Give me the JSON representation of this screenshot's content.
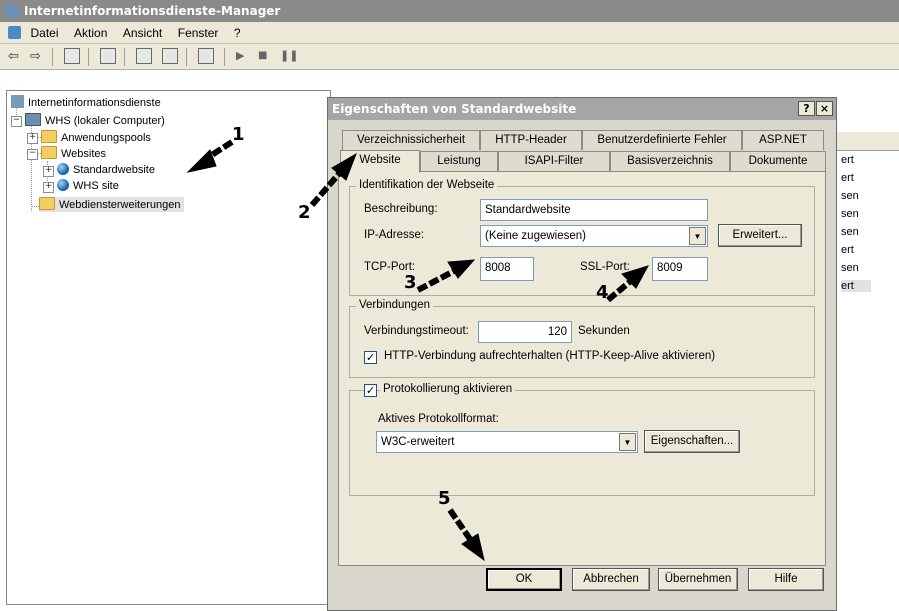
{
  "window": {
    "title": "Internetinformationsdienste-Manager"
  },
  "menu": {
    "items": [
      "Datei",
      "Aktion",
      "Ansicht",
      "Fenster",
      "?"
    ]
  },
  "tree": {
    "root": "Internetinformationsdienste",
    "computer": "WHS (lokaler Computer)",
    "app_pools": "Anwendungspools",
    "websites": "Websites",
    "site_default": "Standardwebsite",
    "site_whs": "WHS site",
    "web_ext": "Webdiensterweiterungen"
  },
  "right_panel": {
    "items": [
      "ert",
      "ert",
      "sen",
      "sen",
      "sen",
      "ert",
      "sen",
      "ert"
    ]
  },
  "dialog": {
    "title": "Eigenschaften von Standardwebsite",
    "help_btn": "?",
    "close_btn": "×",
    "tabs_back": [
      "Verzeichnissicherheit",
      "HTTP-Header",
      "Benutzerdefinierte Fehler",
      "ASP.NET"
    ],
    "tabs_front": [
      "Website",
      "Leistung",
      "ISAPI-Filter",
      "Basisverzeichnis",
      "Dokumente"
    ],
    "ident_group": "Identifikation der Webseite",
    "desc_label": "Beschreibung:",
    "desc_value": "Standardwebsite",
    "ip_label": "IP-Adresse:",
    "ip_value": "(Keine zugewiesen)",
    "advanced_btn": "Erweitert...",
    "tcp_label": "TCP-Port:",
    "tcp_value": "8008",
    "ssl_label": "SSL-Port:",
    "ssl_value": "8009",
    "conn_group": "Verbindungen",
    "timeout_label": "Verbindungstimeout:",
    "timeout_value": "120",
    "timeout_unit": "Sekunden",
    "keepalive_label": "HTTP-Verbindung aufrechterhalten (HTTP-Keep-Alive aktivieren)",
    "keepalive_checked": true,
    "log_label": "Protokollierung aktivieren",
    "log_checked": true,
    "log_format_label": "Aktives Protokollformat:",
    "log_format_value": "W3C-erweitert",
    "log_props_btn": "Eigenschaften...",
    "ok_btn": "OK",
    "cancel_btn": "Abbrechen",
    "apply_btn": "Übernehmen",
    "help_footer_btn": "Hilfe"
  },
  "annotations": {
    "n1": "1",
    "n2": "2",
    "n3": "3",
    "n4": "4",
    "n5": "5"
  }
}
